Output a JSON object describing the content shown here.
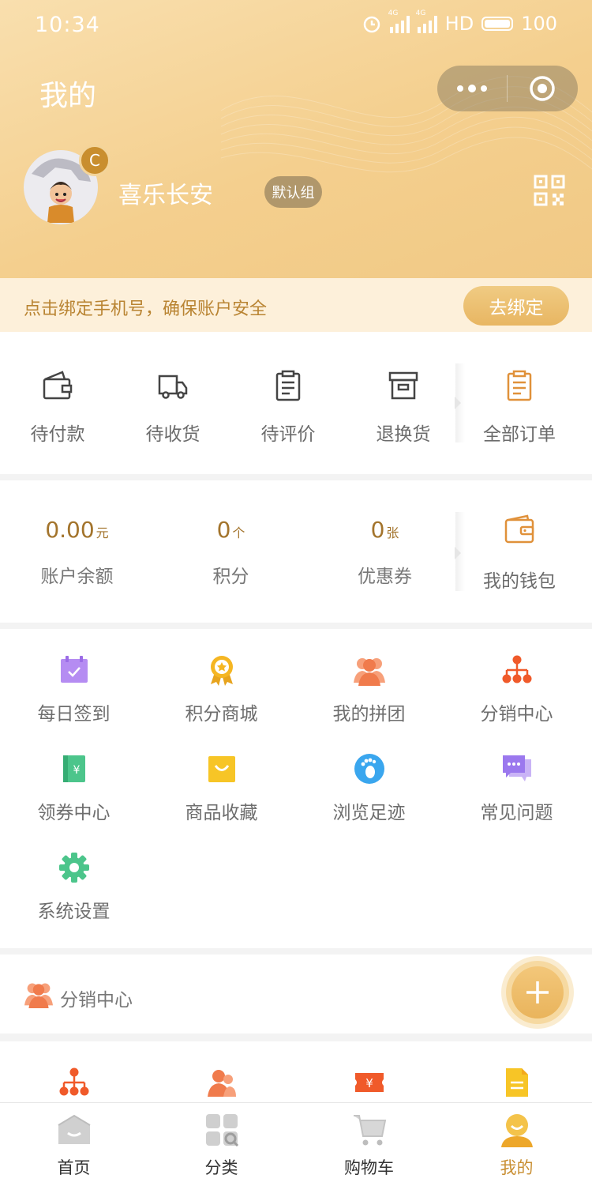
{
  "status_bar": {
    "time": "10:34",
    "network": "HD",
    "battery": "100"
  },
  "header": {
    "title": "我的",
    "username": "喜乐长安",
    "group_badge": "默认组",
    "avatar_badge": "C"
  },
  "bind_phone": {
    "text": "点击绑定手机号，确保账户安全",
    "button": "去绑定"
  },
  "orders": {
    "items": [
      {
        "label": "待付款",
        "icon": "wallet-icon"
      },
      {
        "label": "待收货",
        "icon": "truck-icon"
      },
      {
        "label": "待评价",
        "icon": "clipboard-icon"
      },
      {
        "label": "退换货",
        "icon": "box-icon"
      }
    ],
    "all": {
      "label": "全部订单",
      "icon": "order-list-icon"
    }
  },
  "wallet": {
    "items": [
      {
        "value": "0.00",
        "unit": "元",
        "label": "账户余额"
      },
      {
        "value": "0",
        "unit": "个",
        "label": "积分"
      },
      {
        "value": "0",
        "unit": "张",
        "label": "优惠券"
      }
    ],
    "mine": {
      "label": "我的钱包",
      "icon": "wallet-icon"
    }
  },
  "services": [
    {
      "label": "每日签到",
      "icon": "calendar-check-icon"
    },
    {
      "label": "积分商城",
      "icon": "medal-icon"
    },
    {
      "label": "我的拼团",
      "icon": "group-icon"
    },
    {
      "label": "分销中心",
      "icon": "hierarchy-icon"
    },
    {
      "label": "领券中心",
      "icon": "coupon-book-icon"
    },
    {
      "label": "商品收藏",
      "icon": "shopping-bag-icon"
    },
    {
      "label": "浏览足迹",
      "icon": "footprint-icon"
    },
    {
      "label": "常见问题",
      "icon": "chat-icon"
    },
    {
      "label": "系统设置",
      "icon": "gear-icon"
    }
  ],
  "distribution": {
    "title": "分销中心",
    "icons": [
      "hierarchy-icon",
      "user-icon",
      "ticket-icon",
      "document-icon"
    ]
  },
  "tabbar": [
    {
      "label": "首页",
      "icon": "home-icon",
      "active": false
    },
    {
      "label": "分类",
      "icon": "category-icon",
      "active": false
    },
    {
      "label": "购物车",
      "icon": "cart-icon",
      "active": false
    },
    {
      "label": "我的",
      "icon": "profile-icon",
      "active": true
    }
  ],
  "colors": {
    "header_gradient_start": "#f9dfae",
    "header_gradient_end": "#f1c985",
    "accent": "#c98f33",
    "bind_bar_bg": "#fdf0da"
  }
}
